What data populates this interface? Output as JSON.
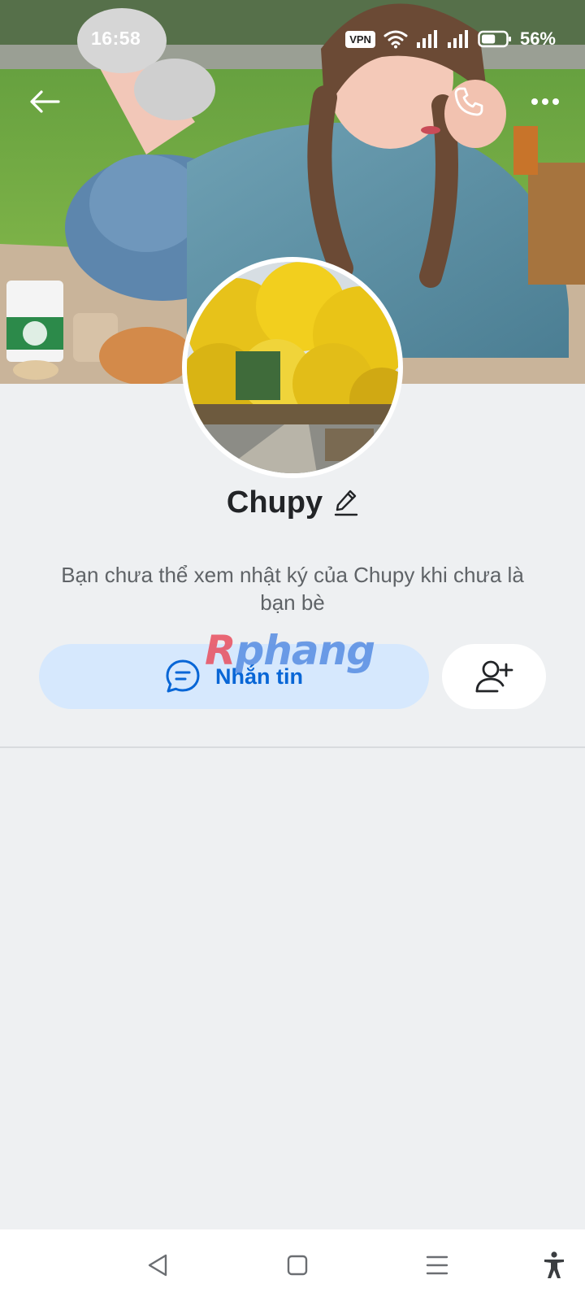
{
  "status_bar": {
    "time": "16:58",
    "vpn_label": "VPN",
    "battery_percent": "56%",
    "battery_level": 0.56,
    "icons": [
      "wifi-icon",
      "signal-icon",
      "signal-icon",
      "battery-icon"
    ]
  },
  "header": {
    "icons": [
      "back-arrow-icon",
      "phone-icon",
      "more-dots-icon"
    ]
  },
  "profile": {
    "name": "Chupy",
    "privacy_note": "Bạn chưa thể xem nhật ký của Chupy khi chưa là bạn bè"
  },
  "actions": {
    "message_label": "Nhắn tin",
    "message_icon": "chat-bubble-icon",
    "add_friend_icon": "add-user-icon"
  },
  "watermark": {
    "first_letter": "R",
    "rest": "phang"
  },
  "nav_bar": {
    "icons": [
      "nav-back-icon",
      "nav-home-icon",
      "nav-recents-icon",
      "accessibility-icon"
    ]
  },
  "colors": {
    "background": "#eef0f2",
    "message_button_bg": "#d6e8fd",
    "accent_blue": "#0866d6",
    "name_text": "#222427",
    "note_text": "#5f6367"
  }
}
